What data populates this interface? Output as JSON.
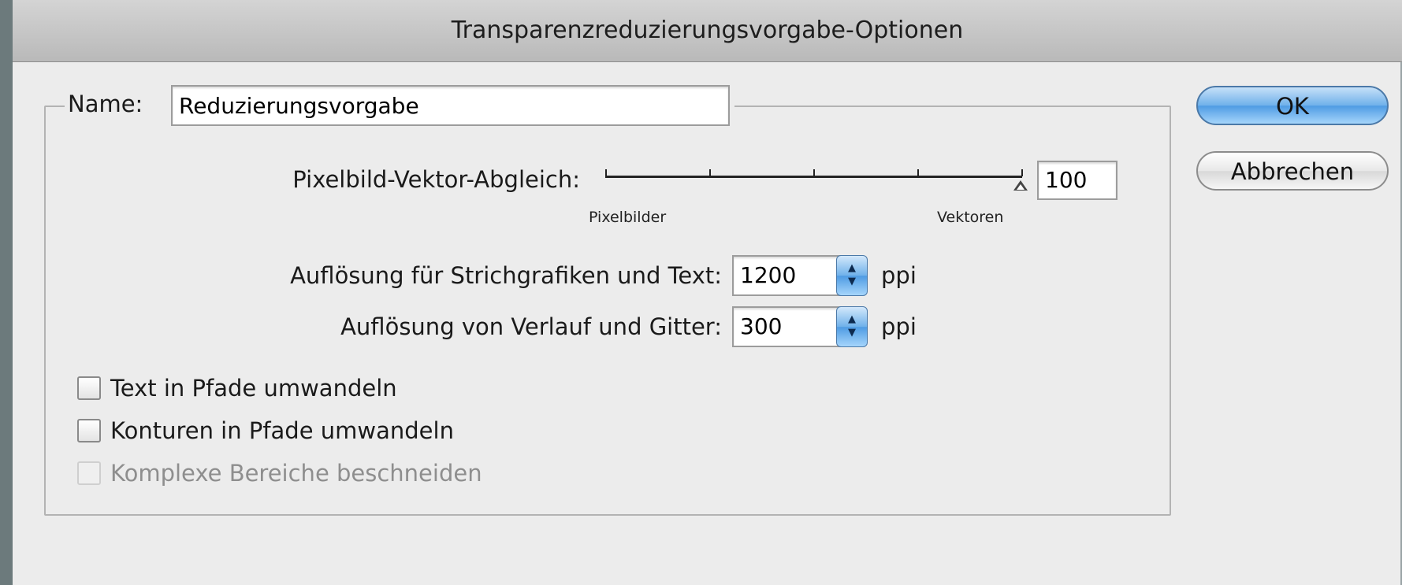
{
  "window": {
    "title": "Transparenzreduzierungsvorgabe-Optionen"
  },
  "name_field": {
    "label": "Name:",
    "value": "Reduzierungsvorgabe"
  },
  "buttons": {
    "ok_label": "OK",
    "cancel_label": "Abbrechen"
  },
  "slider": {
    "label": "Pixelbild-Vektor-Abgleich:",
    "left_label": "Pixelbilder",
    "right_label": "Vektoren",
    "value": "100"
  },
  "resolution_lines": {
    "label": "Auflösung für Strichgrafiken und Text:",
    "value": "1200",
    "unit": "ppi"
  },
  "resolution_gradient": {
    "label": "Auflösung von Verlauf und Gitter:",
    "value": "300",
    "unit": "ppi"
  },
  "checkboxes": [
    {
      "label": "Text in Pfade umwandeln",
      "checked": false,
      "enabled": true
    },
    {
      "label": "Konturen in Pfade umwandeln",
      "checked": false,
      "enabled": true
    },
    {
      "label": "Komplexe Bereiche beschneiden",
      "checked": false,
      "enabled": false
    }
  ],
  "colors": {
    "dialog_bg": "#ececec",
    "accent_blue": "#6fb1ea"
  }
}
